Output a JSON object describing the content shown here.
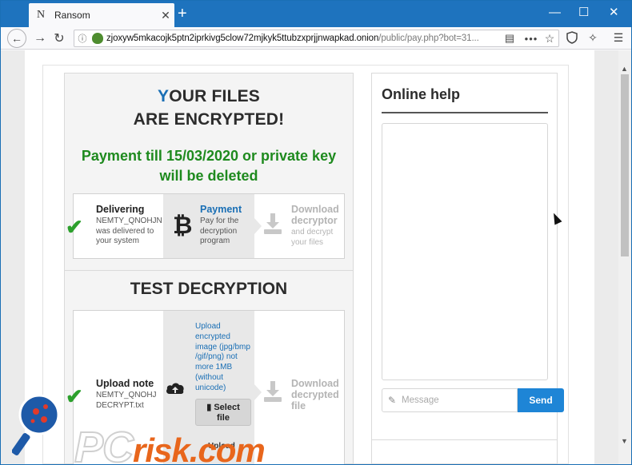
{
  "browser": {
    "tab": {
      "favicon": "N",
      "title": "Ransom",
      "close_glyph": "✕"
    },
    "new_tab_glyph": "+",
    "window_controls": {
      "minimize": "—",
      "maximize": "☐",
      "close": "✕"
    },
    "nav": {
      "back": "←",
      "forward": "→",
      "reload": "↻"
    },
    "url_host": "zjoxyw5mkacojk5ptn2iprkivg5clow72mjkyk5ttubzxprjjnwapkad.onion",
    "url_path": "/public/pay.php?bot=31...",
    "url_more": "•••",
    "icons": [
      "info-icon",
      "onion-icon",
      "reader-view-icon",
      "bookmark-star-icon",
      "shield-icon",
      "tracking-protection-icon",
      "hamburger-menu-icon"
    ]
  },
  "ransom": {
    "headline_first_letter": "Y",
    "headline_line1_rest": "OUR FILES",
    "headline_line2": "ARE ENCRYPTED!",
    "deadline_line1": "Payment till 15/03/2020 or private key",
    "deadline_line2": "will be deleted",
    "steps": [
      {
        "title": "Delivering",
        "desc": [
          "NEMTY_QNOHJN",
          "was delivered to",
          "your system"
        ],
        "state": "done"
      },
      {
        "title": "Payment",
        "desc": [
          "Pay for the",
          "decryption",
          "program"
        ],
        "state": "active"
      },
      {
        "title": "Download",
        "title2": "decryptor",
        "desc": [
          "and decrypt",
          "your files"
        ],
        "state": "pending"
      }
    ],
    "test_title": "TEST DECRYPTION",
    "test_steps": {
      "upload_note_title": "Upload note",
      "upload_note_desc": [
        "NEMTY_QNOHJ",
        "DECRYPT.txt"
      ],
      "upload_image_text": [
        "Upload",
        "encrypted",
        "image (jpg/bmp",
        "/gif/png) not",
        "more 1MB",
        "(without",
        "unicode)"
      ],
      "select_file_label": [
        "Select",
        "file"
      ],
      "upload_below": "Upload",
      "download_title": [
        "Download",
        "decrypted",
        "file"
      ]
    }
  },
  "help": {
    "title": "Online help",
    "message_placeholder": "Message",
    "send_label": "Send"
  },
  "watermark": {
    "pc": "PC",
    "risk": "risk.com"
  },
  "colors": {
    "accent_blue": "#1a6fb5",
    "success_green": "#1e8a1e",
    "send_button": "#1e85d6",
    "tabstrip": "#1e73be"
  }
}
